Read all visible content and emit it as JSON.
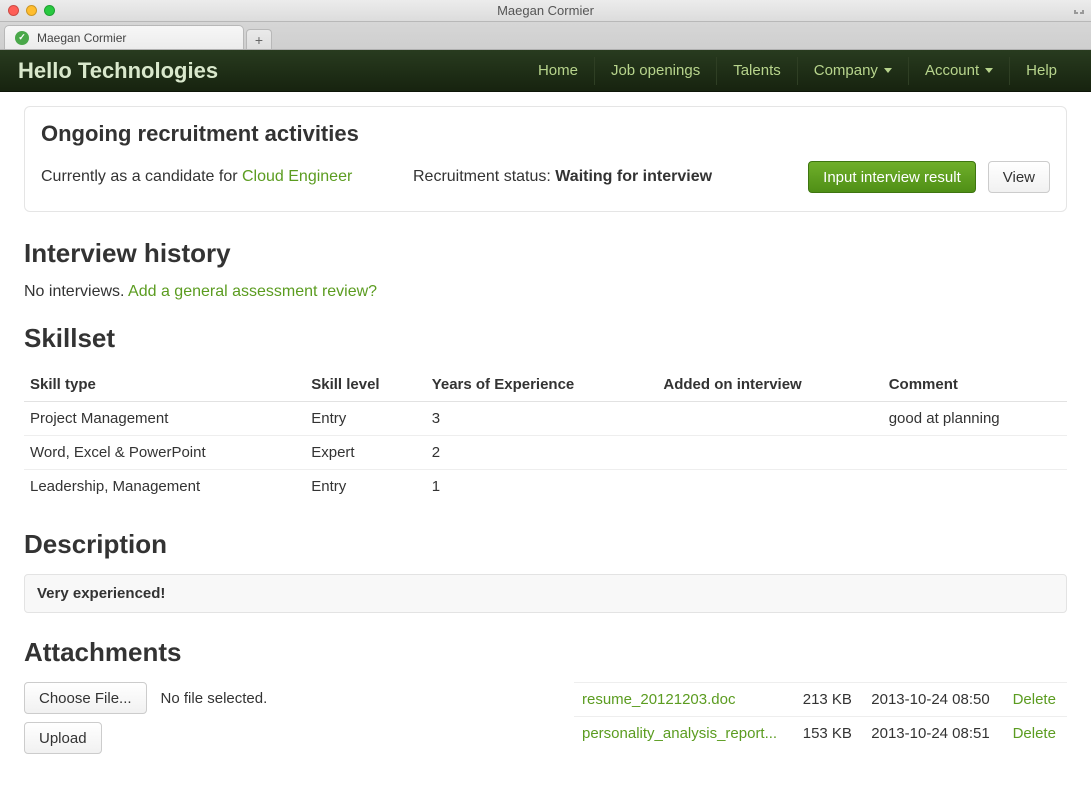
{
  "window": {
    "title": "Maegan Cormier"
  },
  "browser_tab": {
    "label": "Maegan Cormier"
  },
  "nav": {
    "brand": "Hello Technologies",
    "links": {
      "home": "Home",
      "jobs": "Job openings",
      "talents": "Talents",
      "company": "Company",
      "account": "Account",
      "help": "Help"
    }
  },
  "ongoing": {
    "heading": "Ongoing recruitment activities",
    "prefix": "Currently as a candidate for ",
    "position_link": "Cloud Engineer",
    "status_label": "Recruitment status: ",
    "status_value": "Waiting for interview",
    "btn_primary": "Input interview result",
    "btn_view": "View"
  },
  "interview_history": {
    "heading": "Interview history",
    "none_text": "No interviews. ",
    "add_link": "Add a general assessment review?"
  },
  "skillset": {
    "heading": "Skillset",
    "cols": {
      "type": "Skill type",
      "level": "Skill level",
      "years": "Years of Experience",
      "added": "Added on interview",
      "comment": "Comment"
    },
    "rows": [
      {
        "type": "Project Management",
        "level": "Entry",
        "years": "3",
        "added": "",
        "comment": "good at planning"
      },
      {
        "type": "Word, Excel & PowerPoint",
        "level": "Expert",
        "years": "2",
        "added": "",
        "comment": ""
      },
      {
        "type": "Leadership, Management",
        "level": "Entry",
        "years": "1",
        "added": "",
        "comment": ""
      }
    ]
  },
  "description": {
    "heading": "Description",
    "body": "Very experienced!"
  },
  "attachments": {
    "heading": "Attachments",
    "choose_label": "Choose File...",
    "nofile_text": "No file selected.",
    "upload_label": "Upload",
    "delete_label": "Delete",
    "files": [
      {
        "name": "resume_20121203.doc",
        "size": "213 KB",
        "date": "2013-10-24 08:50"
      },
      {
        "name": "personality_analysis_report...",
        "size": "153 KB",
        "date": "2013-10-24 08:51"
      }
    ]
  }
}
